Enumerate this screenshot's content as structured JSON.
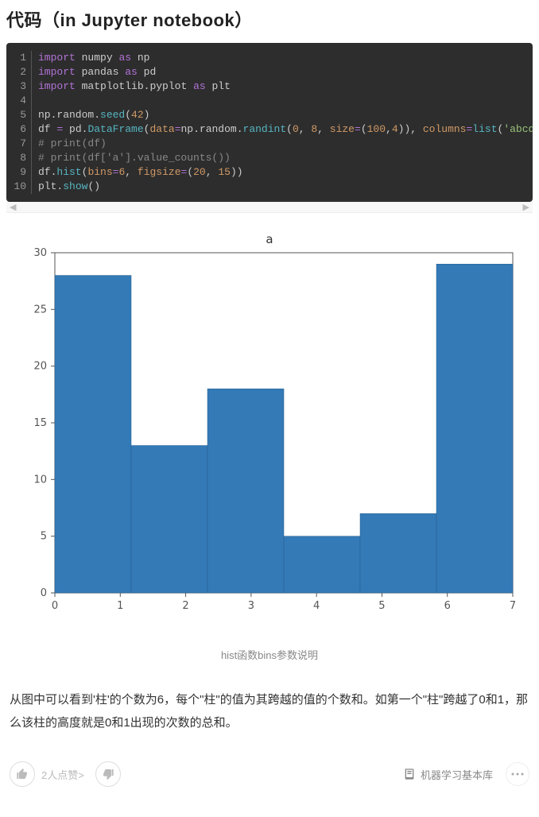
{
  "heading": "代码（in Jupyter notebook）",
  "code": {
    "line_numbers": [
      "1",
      "2",
      "3",
      "4",
      "5",
      "6",
      "7",
      "8",
      "9",
      "10"
    ],
    "lines": [
      [
        [
          "kw",
          "import"
        ],
        [
          "sp",
          " "
        ],
        [
          "mod",
          "numpy"
        ],
        [
          "sp",
          " "
        ],
        [
          "kw",
          "as"
        ],
        [
          "sp",
          " "
        ],
        [
          "mod",
          "np"
        ]
      ],
      [
        [
          "kw",
          "import"
        ],
        [
          "sp",
          " "
        ],
        [
          "mod",
          "pandas"
        ],
        [
          "sp",
          " "
        ],
        [
          "kw",
          "as"
        ],
        [
          "sp",
          " "
        ],
        [
          "mod",
          "pd"
        ]
      ],
      [
        [
          "kw",
          "import"
        ],
        [
          "sp",
          " "
        ],
        [
          "mod",
          "matplotlib.pyplot"
        ],
        [
          "sp",
          " "
        ],
        [
          "kw",
          "as"
        ],
        [
          "sp",
          " "
        ],
        [
          "mod",
          "plt"
        ]
      ],
      [],
      [
        [
          "mod",
          "np.random."
        ],
        [
          "attr",
          "seed"
        ],
        [
          "mod",
          "("
        ],
        [
          "num",
          "42"
        ],
        [
          "mod",
          ")"
        ]
      ],
      [
        [
          "mod",
          "df "
        ],
        [
          "kw",
          "="
        ],
        [
          "mod",
          " pd."
        ],
        [
          "attr",
          "DataFrame"
        ],
        [
          "mod",
          "("
        ],
        [
          "param",
          "data"
        ],
        [
          "kw",
          "="
        ],
        [
          "mod",
          "np.random."
        ],
        [
          "attr",
          "randint"
        ],
        [
          "mod",
          "("
        ],
        [
          "num",
          "0"
        ],
        [
          "mod",
          ", "
        ],
        [
          "num",
          "8"
        ],
        [
          "mod",
          ", "
        ],
        [
          "param",
          "size"
        ],
        [
          "kw",
          "="
        ],
        [
          "mod",
          "("
        ],
        [
          "num",
          "100"
        ],
        [
          "mod",
          ","
        ],
        [
          "num",
          "4"
        ],
        [
          "mod",
          ")), "
        ],
        [
          "param",
          "columns"
        ],
        [
          "kw",
          "="
        ],
        [
          "attr",
          "list"
        ],
        [
          "mod",
          "("
        ],
        [
          "str",
          "'abcd'"
        ],
        [
          "mod",
          "))"
        ]
      ],
      [
        [
          "cmt",
          "# print(df)"
        ]
      ],
      [
        [
          "cmt",
          "# print(df['a'].value_counts())"
        ]
      ],
      [
        [
          "mod",
          "df."
        ],
        [
          "attr",
          "hist"
        ],
        [
          "mod",
          "("
        ],
        [
          "param",
          "bins"
        ],
        [
          "kw",
          "="
        ],
        [
          "num",
          "6"
        ],
        [
          "mod",
          ", "
        ],
        [
          "param",
          "figsize"
        ],
        [
          "kw",
          "="
        ],
        [
          "mod",
          "("
        ],
        [
          "num",
          "20"
        ],
        [
          "mod",
          ", "
        ],
        [
          "num",
          "15"
        ],
        [
          "mod",
          "))"
        ]
      ],
      [
        [
          "mod",
          "plt."
        ],
        [
          "attr",
          "show"
        ],
        [
          "mod",
          "()"
        ]
      ]
    ]
  },
  "scroll_hint_left": "◀",
  "scroll_hint_right": "▶",
  "chart_data": {
    "type": "bar",
    "title": "a",
    "xlabel": "",
    "ylabel": "",
    "xlim": [
      0,
      7
    ],
    "ylim": [
      0,
      30
    ],
    "x_ticks": [
      0,
      1,
      2,
      3,
      4,
      5,
      6,
      7
    ],
    "y_ticks": [
      0,
      5,
      10,
      15,
      20,
      25,
      30
    ],
    "bin_edges": [
      0,
      1.1667,
      2.3333,
      3.5,
      4.6667,
      5.8333,
      7
    ],
    "values": [
      28,
      13,
      18,
      5,
      7,
      29
    ],
    "bar_color": "#337ab7"
  },
  "caption": "hist函数bins参数说明",
  "body_text": "从图中可以看到'柱'的个数为6，每个\"柱\"的值为其跨越的值的个数和。如第一个\"柱\"跨越了0和1，那么该柱的高度就是0和1出现的次数的总和。",
  "footer": {
    "like_count": "2人点赞",
    "like_arrow": ">",
    "book_label": "机器学习基本库"
  }
}
